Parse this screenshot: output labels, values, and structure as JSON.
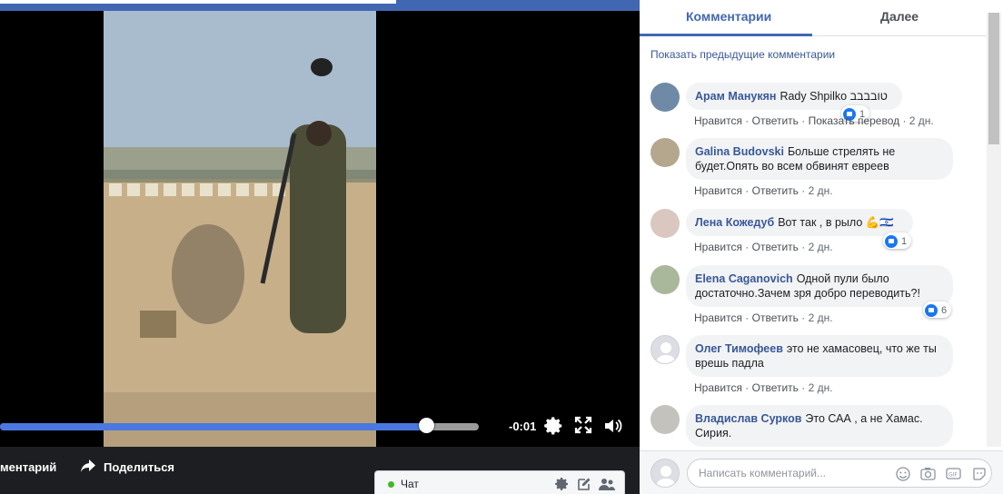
{
  "video": {
    "time_remaining": "-0:01",
    "progress": 0.89
  },
  "actions": {
    "comment_label": "ментарий",
    "share_label": "Поделиться"
  },
  "chat": {
    "label": "Чат",
    "status_color": "#42b72a"
  },
  "panel": {
    "tabs": [
      {
        "label": "Комментарии",
        "active": true
      },
      {
        "label": "Далее",
        "active": false
      }
    ],
    "show_previous": "Показать предыдущие комментарии",
    "comments": [
      {
        "author": "Арам Манукян",
        "text": "Rady Shpilko טובבבב",
        "links": [
          "Нравится",
          "Ответить",
          "Показать перевод",
          "2 дн."
        ],
        "likes": "1"
      },
      {
        "author": "Galina Budovski",
        "text": "Больше стрелять не будет.Опять во всем обвинят евреев",
        "links": [
          "Нравится",
          "Ответить",
          "2 дн."
        ],
        "likes": ""
      },
      {
        "author": "Лена Кожедуб",
        "text": "Вот так , в рыло 💪🇮🇱",
        "links": [
          "Нравится",
          "Ответить",
          "2 дн."
        ],
        "likes": "1"
      },
      {
        "author": "Elena Caganovich",
        "text": "Одной пули было достаточно.Зачем зря добро переводить?!",
        "links": [
          "Нравится",
          "Ответить",
          "2 дн."
        ],
        "likes": "6"
      },
      {
        "author": "Олег Тимофеев",
        "text": "это не хамасовец, что же ты врешь падла",
        "links": [
          "Нравится",
          "Ответить",
          "2 дн."
        ],
        "likes": ""
      },
      {
        "author": "Владислав Сурков",
        "text": "Это САА , а не Хамас. Сирия.",
        "links": [],
        "likes": ""
      }
    ],
    "compose_placeholder": "Написать комментарий..."
  },
  "colors": {
    "brand": "#4267b2",
    "link": "#385898",
    "progress": "#4a78e0"
  }
}
